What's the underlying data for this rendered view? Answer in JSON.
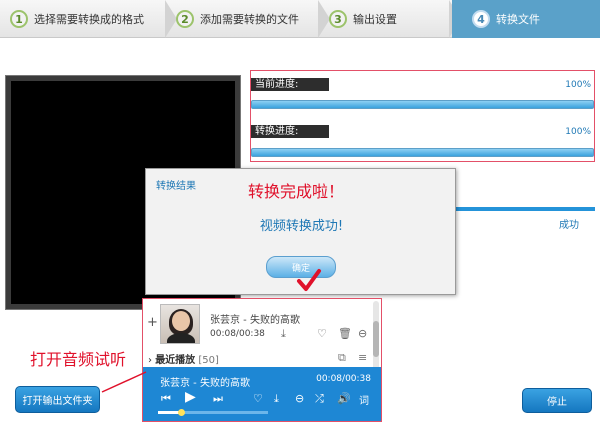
{
  "steps": [
    {
      "num": "1",
      "label": "选择需要转换成的格式"
    },
    {
      "num": "2",
      "label": "添加需要转换的文件"
    },
    {
      "num": "3",
      "label": "输出设置"
    },
    {
      "num": "4",
      "label": "转换文件"
    }
  ],
  "progress": {
    "current_label": "当前进度:",
    "current_pct": "100%",
    "current_value": 1.0,
    "convert_label": "转换进度:",
    "convert_pct": "100%",
    "convert_value": 1.0
  },
  "status": "成功",
  "dialog": {
    "title": "转换结果",
    "message": "视频转换成功!",
    "ok_label": "确定"
  },
  "annotations": {
    "done": "转换完成啦！",
    "audio": "打开音频试听"
  },
  "player": {
    "song": "张芸京 - 失败的高歌",
    "time": "00:08/00:38",
    "recent_label": "最近播放",
    "recent_count": "[50]",
    "now_song": "张芸京 - 失败的高歌",
    "now_time": "00:08/00:38",
    "progress": 0.21,
    "lyrics_label": "词"
  },
  "buttons": {
    "open_folder": "打开输出文件夹",
    "stop": "停止"
  },
  "colors": {
    "accent": "#1f78b5",
    "annotation": "#e0112b",
    "active_step": "#5aa1c9"
  }
}
